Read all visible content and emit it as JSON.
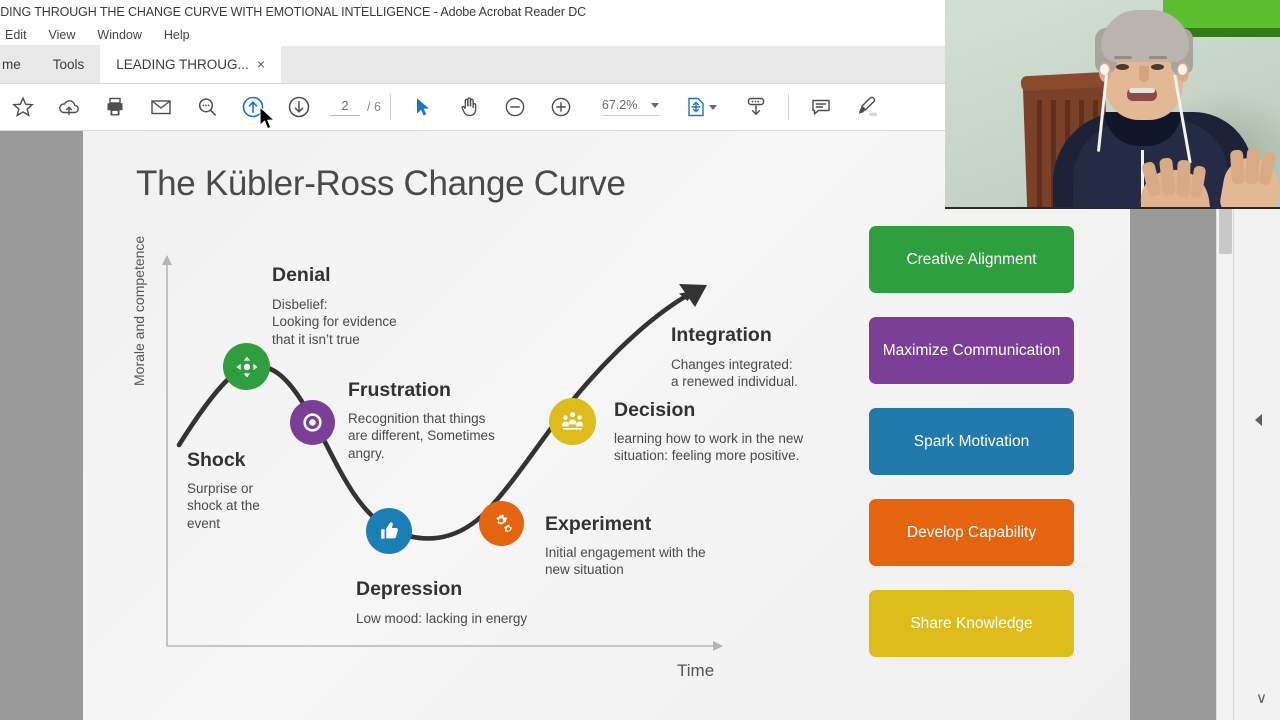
{
  "window": {
    "title": "ADING THROUGH THE CHANGE CURVE WITH EMOTIONAL INTELLIGENCE - Adobe Acrobat Reader DC"
  },
  "menubar": {
    "items": [
      {
        "label": "Edit"
      },
      {
        "label": "View"
      },
      {
        "label": "Window"
      },
      {
        "label": "Help"
      }
    ]
  },
  "tabs": [
    {
      "label": "me",
      "name": "tab-home"
    },
    {
      "label": "Tools",
      "name": "tab-tools"
    },
    {
      "label": "LEADING THROUG...",
      "name": "tab-document",
      "close": "×"
    }
  ],
  "toolbar": {
    "icons": [
      {
        "name": "star-icon",
        "title": "Add to favorites"
      },
      {
        "name": "cloud-upload-icon",
        "title": "Save to cloud"
      },
      {
        "name": "print-icon",
        "title": "Print"
      },
      {
        "name": "email-icon",
        "title": "Email"
      },
      {
        "name": "search-icon",
        "title": "Find"
      },
      {
        "name": "page-up-icon",
        "title": "Previous page"
      },
      {
        "name": "page-down-icon",
        "title": "Next page"
      },
      {
        "name": "select-tool-icon",
        "title": "Select"
      },
      {
        "name": "hand-tool-icon",
        "title": "Pan"
      },
      {
        "name": "zoom-out-icon",
        "title": "Zoom out"
      },
      {
        "name": "zoom-in-icon",
        "title": "Zoom in"
      },
      {
        "name": "fit-page-icon",
        "title": "Fit page"
      },
      {
        "name": "scroll-mode-icon",
        "title": "Scroll mode"
      },
      {
        "name": "comment-icon",
        "title": "Comment"
      },
      {
        "name": "highlight-icon",
        "title": "Highlight"
      }
    ],
    "page_current": "2",
    "page_total": "/ 6",
    "zoom_value": "67.2%"
  },
  "chart_data": {
    "type": "line",
    "title": "The Kübler-Ross Change Curve",
    "xlabel": "Time",
    "ylabel": "Morale and competence",
    "grid": false,
    "legend": "none",
    "x": [
      0,
      1,
      2,
      3,
      4,
      5,
      6,
      7
    ],
    "values": [
      40,
      62,
      74,
      58,
      28,
      22,
      30,
      58
    ],
    "annotations": [
      "Shock",
      "Denial",
      "Frustration",
      "Depression",
      "Experiment",
      "Decision",
      "Integration"
    ],
    "points": [
      {
        "stage": "Denial",
        "x": 2,
        "y": 74,
        "color": "#2e9e3e",
        "icon": "move-arrows-icon"
      },
      {
        "stage": "Frustration",
        "x": 3,
        "y": 58,
        "color": "#7b3f98",
        "icon": "target-ring-icon"
      },
      {
        "stage": "Depression",
        "x": 4,
        "y": 28,
        "color": "#1b7fb5",
        "icon": "thumbs-up-icon"
      },
      {
        "stage": "Experiment",
        "x": 5,
        "y": 22,
        "color": "#e4640f",
        "icon": "gears-icon"
      },
      {
        "stage": "Decision",
        "x": 6,
        "y": 48,
        "color": "#ddbc1b",
        "icon": "people-group-icon"
      }
    ]
  },
  "document": {
    "title": "The Kübler-Ross Change Curve",
    "axis_y": "Morale and competence",
    "axis_x": "Time",
    "stages": [
      {
        "name": "shock",
        "title": "Shock",
        "body": "Surprise or\nshock at the\nevent"
      },
      {
        "name": "denial",
        "title": "Denial",
        "body": "Disbelief:\nLooking for evidence\nthat it isn’t true"
      },
      {
        "name": "frustration",
        "title": "Frustration",
        "body": "Recognition that things\nare different, Sometimes\nangry."
      },
      {
        "name": "depression",
        "title": "Depression",
        "body": "Low mood: lacking in energy"
      },
      {
        "name": "experiment",
        "title": "Experiment",
        "body": "Initial engagement with the\nnew situation"
      },
      {
        "name": "decision",
        "title": "Decision",
        "body": "learning how to work in the new\nsituation: feeling more positive."
      },
      {
        "name": "integration",
        "title": "Integration",
        "body": "Changes integrated:\na renewed individual."
      }
    ],
    "actions": [
      {
        "label": "Creative Alignment",
        "color": "#2e9e3e"
      },
      {
        "label": "Maximize Communication",
        "color": "#7b3f98"
      },
      {
        "label": "Spark Motivation",
        "color": "#2279ac"
      },
      {
        "label": "Develop Capability",
        "color": "#e4640f"
      },
      {
        "label": "Share Knowledge",
        "color": "#ddbc1b"
      }
    ]
  },
  "rail": {
    "collapse_icon": "collapse-panel-icon",
    "chevron": "∨"
  },
  "webcam": {
    "name": "webcam-overlay"
  }
}
